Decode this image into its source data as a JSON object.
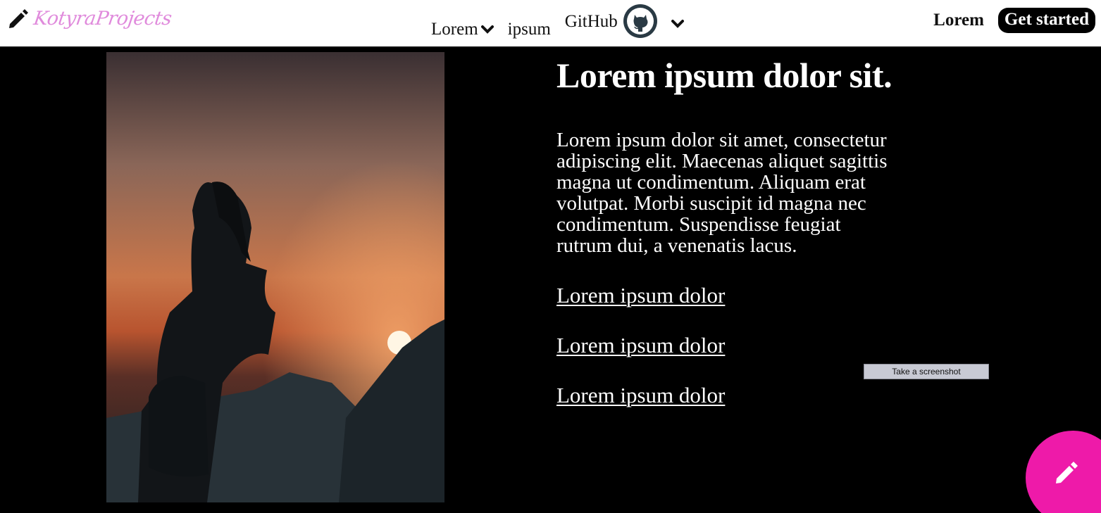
{
  "header": {
    "brand_name": "KotyraProjects",
    "brand_icon": "pencil-icon",
    "nav": [
      {
        "label": "Lorem",
        "icon": "chevron-down-icon"
      },
      {
        "label": "ipsum"
      },
      {
        "label": "GitHub",
        "icon": "github-icon"
      }
    ],
    "login_label": "Lorem",
    "cta_label": "Get started"
  },
  "hero": {
    "image_icon": "silhouette-sunset-image"
  },
  "main": {
    "title": "Lorem ipsum dolor sit.",
    "paragraph": "Lorem ipsum dolor sit amet, consectetur adipiscing elit. Maecenas aliquet sagittis magna ut condimentum. Aliquam erat volutpat. Morbi suscipit id magna nec condimentum. Suspendisse feugiat rutrum dui, a venenatis lacus.",
    "links": [
      "Lorem ipsum dolor",
      "Lorem ipsum dolor",
      "Lorem ipsum dolor"
    ]
  },
  "overlay": {
    "screenshot_label": "Take a screenshot"
  },
  "fab": {
    "icon": "pencil-icon",
    "color": "#ee1aa9"
  },
  "colors": {
    "background": "#000000",
    "header_bg": "#ffffff",
    "brand": "#e08bdc",
    "accent": "#ee1aa9"
  }
}
